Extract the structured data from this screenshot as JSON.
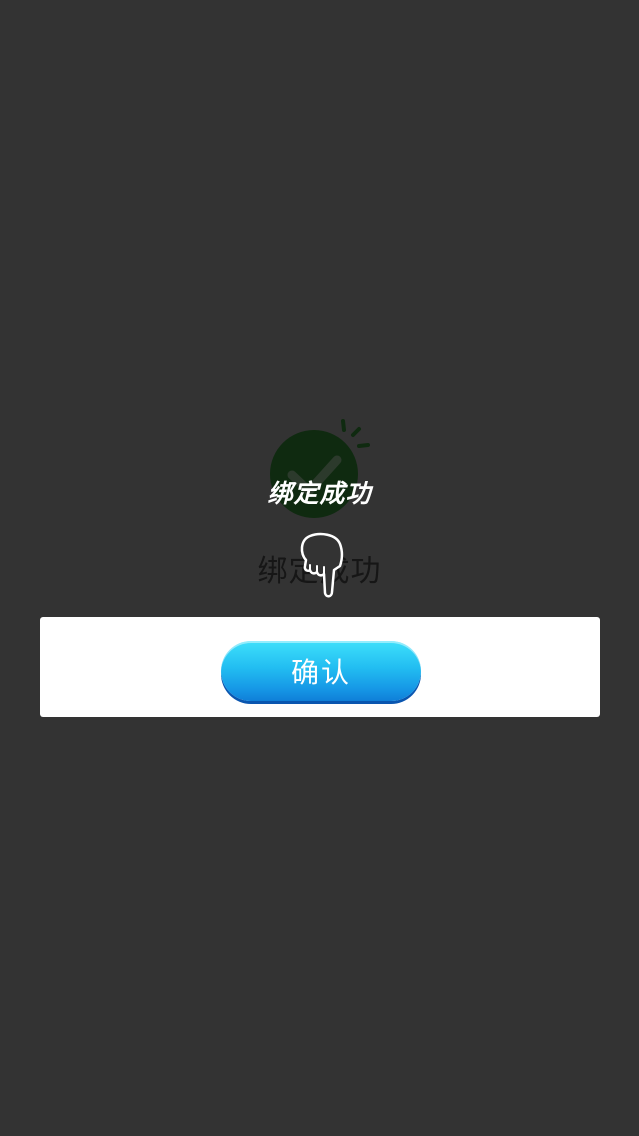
{
  "dialog": {
    "status_text": "绑定成功",
    "confirm_label": "确认"
  },
  "guide_overlay": {
    "caption": "绑定成功"
  },
  "icons": {
    "success": "check-circle-icon",
    "pointer": "pointing-hand-icon"
  },
  "colors": {
    "background": "#333333",
    "success_green": "#0f2a10",
    "button_top": "#3ee0fb",
    "button_bottom": "#0f7fd8",
    "card": "#ffffff"
  }
}
